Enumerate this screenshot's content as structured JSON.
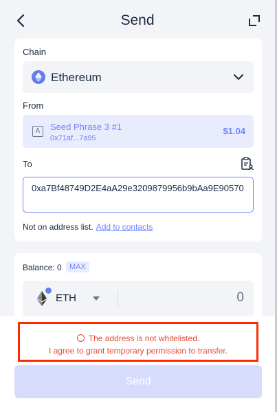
{
  "header": {
    "title": "Send"
  },
  "chain": {
    "label": "Chain",
    "selected": "Ethereum"
  },
  "from": {
    "label": "From",
    "account_name": "Seed Phrase 3 #1",
    "account_address": "0x71af...7a95",
    "account_balance": "$1.04",
    "account_icon_letter": "A"
  },
  "to": {
    "label": "To",
    "address_value": "0xa7Bf48749D2E4aA29e3209879956b9bAa9E90570",
    "note": "Not on address list.",
    "add_contact_link": "Add to contacts"
  },
  "amount": {
    "balance_label": "Balance: 0",
    "max_label": "MAX",
    "token_symbol": "ETH",
    "amount_value": "0"
  },
  "warning": {
    "line1": "The address is not whitelisted.",
    "line2": "I agree to grant temporary permission to transfer."
  },
  "footer": {
    "send_label": "Send"
  },
  "colors": {
    "accent": "#7084ff",
    "warning": "#e34935",
    "highlight_border": "#ff2a00",
    "eth": "#627eea"
  }
}
